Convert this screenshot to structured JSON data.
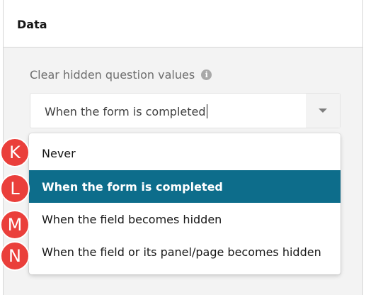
{
  "section": {
    "title": "Data"
  },
  "property": {
    "label": "Clear hidden question values",
    "info_glyph": "i",
    "icon": "info-icon"
  },
  "select": {
    "value": "When the form is completed",
    "toggle_icon": "chevron-down-icon"
  },
  "dropdown": {
    "options": [
      {
        "label": "Never",
        "selected": false
      },
      {
        "label": "When the form is completed",
        "selected": true
      },
      {
        "label": "When the field becomes hidden",
        "selected": false
      },
      {
        "label": "When the field or its panel/page becomes hidden",
        "selected": false
      }
    ]
  },
  "markers": [
    "K",
    "L",
    "M",
    "N"
  ],
  "colors": {
    "selected_bg": "#0d6d8b",
    "marker_red": "#ea3f3b",
    "panel_bg": "#f3f3f3"
  }
}
